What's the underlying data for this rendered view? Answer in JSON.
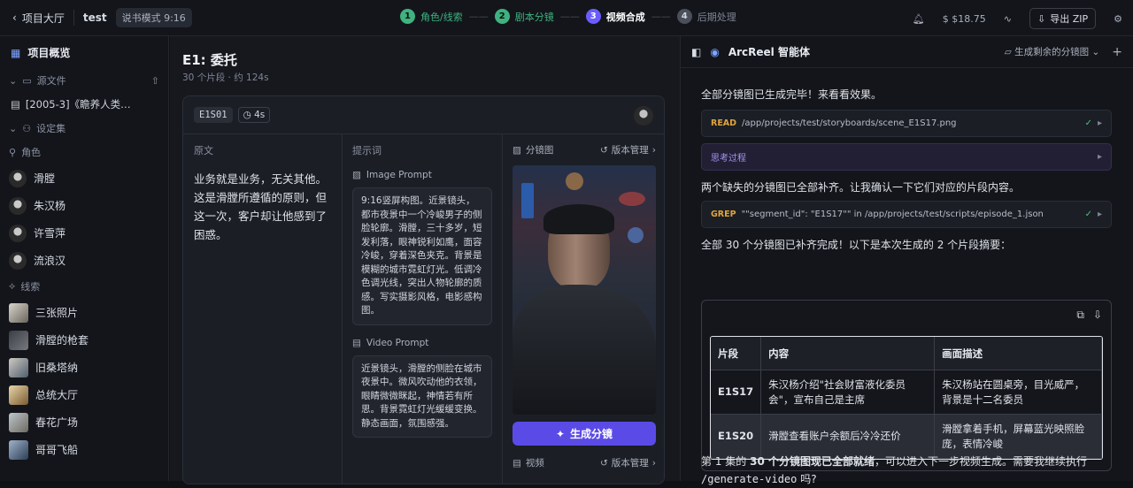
{
  "topbar": {
    "back_label": "项目大厅",
    "project": "test",
    "mode_badge": "说书模式 9:16",
    "steps": [
      {
        "num": "1",
        "label": "角色/线索",
        "color": "#3fb27f"
      },
      {
        "num": "2",
        "label": "剧本分镜",
        "color": "#3fb27f"
      },
      {
        "num": "3",
        "label": "视频合成",
        "color": "#6a5cff"
      },
      {
        "num": "4",
        "label": "后期处理",
        "color": "#4a4f5a"
      }
    ],
    "cost": "$18.75",
    "export_label": "导出 ZIP"
  },
  "sidebar": {
    "title": "项目概览",
    "source_section": "源文件",
    "source_file": "[2005-3]《瞻养人类…",
    "settings_section": "设定集",
    "roles_label": "角色",
    "roles": [
      "滑膛",
      "朱汉杨",
      "许雪萍",
      "流浪汉"
    ],
    "clues_label": "线索",
    "clues": [
      "三张照片",
      "滑膛的枪套",
      "旧桑塔纳",
      "总统大厅",
      "春花广场",
      "哥哥飞船"
    ]
  },
  "episode": {
    "title": "E1: 委托",
    "subtitle": "30 个片段 · 约 124s",
    "segment_id": "E1S01",
    "duration": "4s",
    "orig_label": "原文",
    "orig_text": "业务就是业务，无关其他。这是滑膛所遵循的原则，但这一次，客户却让他感到了困惑。",
    "prompt_label": "提示词",
    "image_prompt_label": "Image Prompt",
    "image_prompt": "9:16竖屏构图。近景镜头，都市夜景中一个冷峻男子的侧脸轮廓。滑膛，三十多岁，短发利落，眼神锐利如鹰，面容冷峻，穿着深色夹克。背景是模糊的城市霓虹灯光。低调冷色调光线，突出人物轮廓的质感。写实摄影风格，电影感构图。",
    "video_prompt_label": "Video Prompt",
    "video_prompt": "近景镜头，滑膛的侧脸在城市夜景中。微风吹动他的衣领，眼睛微微眯起，神情若有所思。背景霓虹灯光缓缓变换。静态画面，氛围感强。",
    "storyboard_label": "分镜图",
    "version_label": "版本管理",
    "generate_label": "生成分镜",
    "video_label": "视频"
  },
  "assistant": {
    "title": "ArcReel 智能体",
    "action": "生成剩余的分镜图",
    "msg1": "全部分镜图已生成完毕！来看看效果。",
    "tool1_kw": "READ",
    "tool1_text": "/app/projects/test/storyboards/scene_E1S17.png",
    "think_label": "思考过程",
    "msg2": "两个缺失的分镜图已全部补齐。让我确认一下它们对应的片段内容。",
    "tool2_kw": "GREP",
    "tool2_text": "\"\"segment_id\": \"E1S17\"\" in /app/projects/test/scripts/episode_1.json",
    "msg3": "全部 30 个分镜图已补齐完成！以下是本次生成的 2 个片段摘要：",
    "table_headers": [
      "片段",
      "内容",
      "画面描述"
    ],
    "table_rows": [
      [
        "E1S17",
        "朱汉杨介绍\"社会财富液化委员会\"，宣布自己是主席",
        "朱汉杨站在圆桌旁，目光威严，背景是十二名委员"
      ],
      [
        "E1S20",
        "滑膛查看账户余额后冷冷还价",
        "滑膛拿着手机，屏幕蓝光映照脸庞，表情冷峻"
      ]
    ],
    "final_a": "第 1 集的 ",
    "final_b": "30 个分镜图现已全部就绪",
    "final_c": "，可以进入下一步视频生成。需要我继续执行 ",
    "final_cmd": "/generate-video",
    "final_d": " 吗?"
  }
}
